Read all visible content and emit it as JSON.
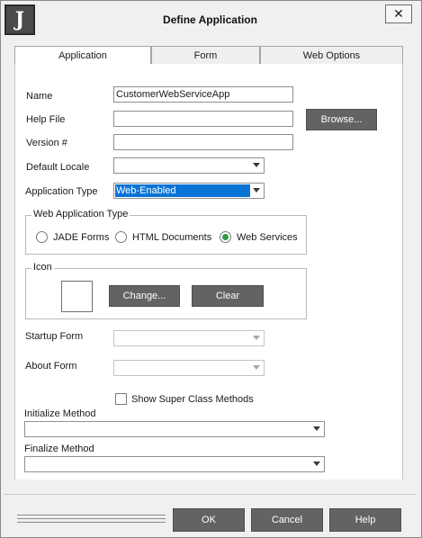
{
  "window": {
    "title": "Define Application",
    "logo_letter": "J",
    "close_glyph": "✕"
  },
  "tabs": [
    {
      "label": "Application",
      "active": true
    },
    {
      "label": "Form",
      "active": false
    },
    {
      "label": "Web Options",
      "active": false
    }
  ],
  "form": {
    "name": {
      "label": "Name",
      "value": "CustomerWebServiceApp"
    },
    "help_file": {
      "label": "Help File",
      "value": ""
    },
    "browse_label": "Browse...",
    "version": {
      "label": "Version #",
      "value": ""
    },
    "default_locale": {
      "label": "Default Locale",
      "value": ""
    },
    "application_type": {
      "label": "Application Type",
      "value": "Web-Enabled"
    },
    "web_app_type": {
      "title": "Web Application Type",
      "options": [
        {
          "label": "JADE Forms",
          "checked": false
        },
        {
          "label": "HTML Documents",
          "checked": false
        },
        {
          "label": "Web Services",
          "checked": true
        }
      ]
    },
    "icon": {
      "title": "Icon",
      "change_label": "Change...",
      "clear_label": "Clear"
    },
    "startup_form": {
      "label": "Startup Form",
      "value": ""
    },
    "about_form": {
      "label": "About Form",
      "value": ""
    },
    "show_super_class": {
      "label": "Show Super Class Methods",
      "checked": false
    },
    "initialize_method": {
      "label": "Initialize Method",
      "value": ""
    },
    "finalize_method": {
      "label": "Finalize Method",
      "value": ""
    }
  },
  "footer": {
    "ok_label": "OK",
    "cancel_label": "Cancel",
    "help_label": "Help"
  },
  "colors": {
    "button_bg": "#636363",
    "selection": "#0a74d6",
    "radio_checked": "#2c9c45"
  }
}
